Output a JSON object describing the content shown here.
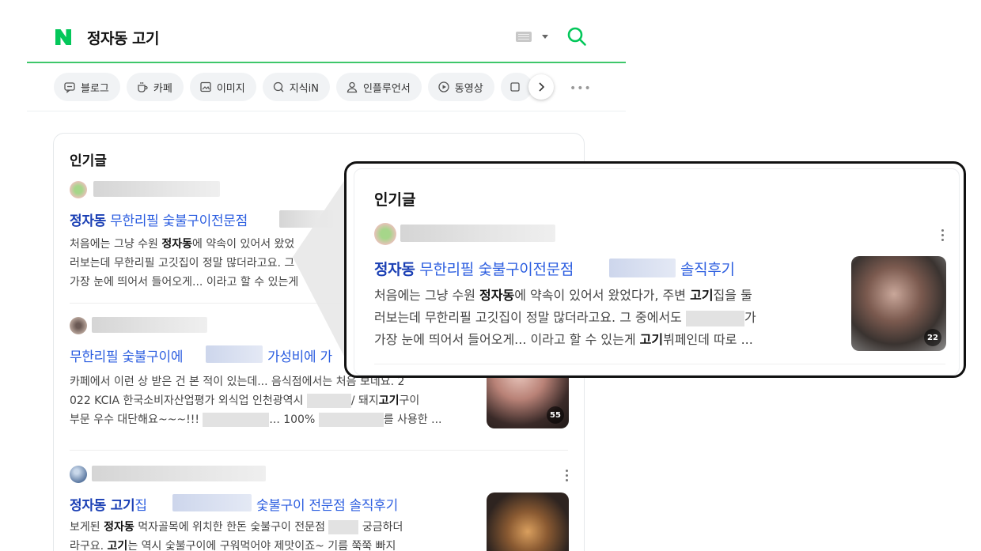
{
  "search": {
    "query": "정자동 고기"
  },
  "tabs": [
    {
      "label": "블로그",
      "icon": "blog-icon"
    },
    {
      "label": "카페",
      "icon": "cafe-icon"
    },
    {
      "label": "이미지",
      "icon": "image-icon"
    },
    {
      "label": "지식iN",
      "icon": "knowledge-icon"
    },
    {
      "label": "인플루언서",
      "icon": "influencer-icon"
    },
    {
      "label": "동영상",
      "icon": "video-icon"
    }
  ],
  "popular": {
    "title": "인기글",
    "posts": [
      {
        "title_bold": "정자동",
        "title_rest": " 무한리필 숯불구이전문점",
        "title_tail": "솔직후기",
        "body_html": "처음에는 그냥 수원 <b>정자동</b>에 약속이 있어서 왔었다가, 주변 <b>고기</b>집을 둘러보는데 무한리필 고깃집이 정말 많더라고요. 그 중에서도 ",
        "body_html_zoom_line1": "처음에는 그냥 수원 <b>정자동</b>에 약속이 있어서 왔었다가, 주변 <b>고기</b>집을 둘",
        "body_html_zoom_line2": "러보는데 무한리필 고깃집이 정말 많더라고요. 그 중에서도 ",
        "body_html_zoom_line2_tail": "가",
        "body_html_zoom_line3": "가장 눈에 띄어서 들어오게... 이라고 할 수 있는게 <b>고기</b>뷔페인데 따로 ...",
        "card_line1": "처음에는 그냥 수원 <b>정자동</b>에 약속이 있어서 왔었",
        "card_line2": "러보는데 무한리필 고깃집이 정말 많더라고요. 그",
        "card_line3": "가장 눈에 띄어서 들어오게... 이라고 할 수 있는게",
        "photo_count": "22"
      },
      {
        "title_part1": "무한리필 숯불구이에",
        "title_part2": "가성비에 가",
        "line1": "카페에서 이런 상 받은 건 본 적이 있는데... 음식점에서는 처음 보네요. 2",
        "line2_a": "022 KCIA 한국소비자산업평가 외식업 인천광역시",
        "line2_b": "/ 돼지",
        "line2_bold": "고기",
        "line2_c": "구이",
        "line3_a": "부문 우수 대단해요~~~!!!",
        "line3_b": "... 100%",
        "line3_c": "를 사용한 ...",
        "photo_count": "55"
      },
      {
        "title_bold1": "정자동 고기",
        "title_rest1": "집",
        "title_tail": "숯불구이 전문점 솔직후기",
        "line1_a": "보게된",
        "line1_bold": "정자동",
        "line1_b": "먹자골목에 위치한 한돈 숯불구이 전문점",
        "line1_c": "궁금하더",
        "line2_a": "라구요.",
        "line2_bold": "고기",
        "line2_b": "는 역시 숯불구이에 구워먹어야 제맛이죠~ 기름 쭉쭉 빠지"
      }
    ]
  },
  "colors": {
    "brand_green": "#03c75a",
    "link_blue": "#2c5ee0",
    "search_underline": "#3ec76a"
  }
}
